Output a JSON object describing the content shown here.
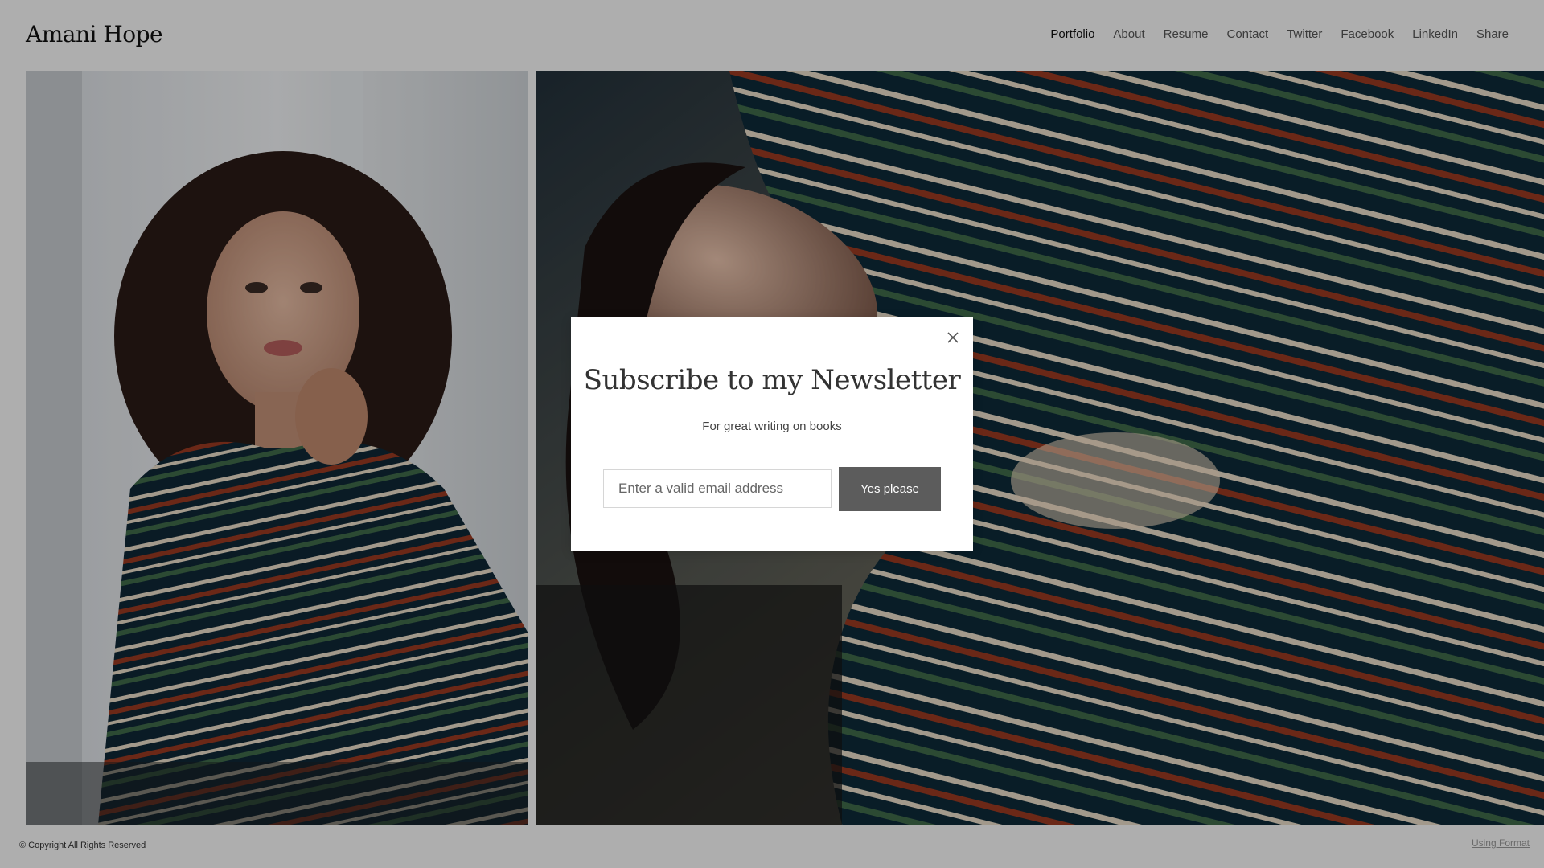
{
  "site": {
    "title": "Amani Hope"
  },
  "nav": {
    "items": [
      {
        "label": "Portfolio",
        "active": true
      },
      {
        "label": "About"
      },
      {
        "label": "Resume"
      },
      {
        "label": "Contact"
      },
      {
        "label": "Twitter"
      },
      {
        "label": "Facebook"
      },
      {
        "label": "LinkedIn"
      },
      {
        "label": "Share"
      }
    ]
  },
  "gallery": {
    "photos": [
      {
        "name": "portrait-seated-striped-suit"
      },
      {
        "name": "portrait-reclining-striped-suit"
      }
    ]
  },
  "footer": {
    "copyright": "© Copyright All Rights Reserved",
    "using_format": "Using Format"
  },
  "modal": {
    "title": "Subscribe to my Newsletter",
    "subtitle": "For great writing on books",
    "email_placeholder": "Enter a valid email address",
    "submit_label": "Yes please",
    "close_icon": "close-icon"
  },
  "colors": {
    "overlay": "#000000",
    "button_bg": "#5c5c5c",
    "suit_navy": "#0e2a3a",
    "stripe_red": "#9a3a22",
    "stripe_green": "#3f6a4a",
    "stripe_cream": "#e8dcc8"
  }
}
